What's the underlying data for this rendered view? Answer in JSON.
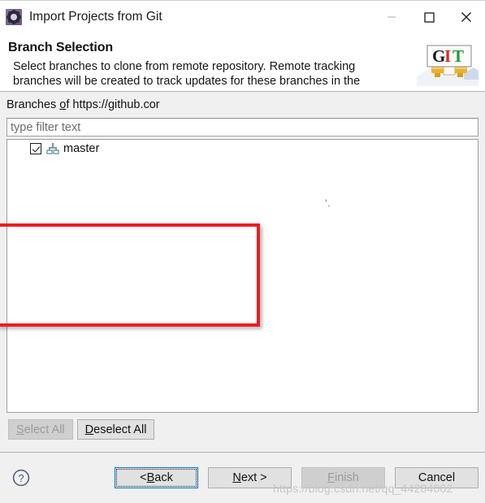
{
  "window": {
    "title": "Import Projects from Git",
    "icon": "eclipse-gear-icon",
    "controls": {
      "minimize": "minimize-icon",
      "maximize": "maximize-icon",
      "close": "close-icon"
    }
  },
  "header": {
    "title": "Branch Selection",
    "description": "Select branches to clone from remote repository. Remote tracking branches will be created to track updates for these branches in the",
    "logo": {
      "letters": [
        "G",
        "I",
        "T"
      ],
      "colors": [
        "#1a1a1a",
        "#d92c20",
        "#1f9a3c"
      ]
    }
  },
  "main": {
    "branches_label_prefix": "Branches ",
    "branches_label_mnemonic": "o",
    "branches_label_suffix": "f https://github.cor",
    "redaction_tail": "'.",
    "filter": {
      "placeholder": "type filter text",
      "value": ""
    },
    "tree": {
      "items": [
        {
          "label": "master",
          "checked": true,
          "icon": "git-branch-icon"
        }
      ]
    },
    "annotation": {
      "shape": "rectangle",
      "color": "#ee1c20"
    }
  },
  "select_bar": {
    "select_all": {
      "label_mnemonic": "S",
      "label_rest": "elect All",
      "enabled": false
    },
    "deselect_all": {
      "label_mnemonic": "D",
      "label_rest": "eselect All",
      "enabled": true
    }
  },
  "footer": {
    "help_icon": "help-question-icon",
    "buttons": [
      {
        "name": "back",
        "prefix": "< ",
        "mnemonic": "B",
        "suffix": "ack",
        "enabled": true,
        "focused": true
      },
      {
        "name": "next",
        "prefix": "",
        "mnemonic": "N",
        "suffix": "ext >",
        "enabled": true,
        "focused": false
      },
      {
        "name": "finish",
        "prefix": "",
        "mnemonic": "F",
        "suffix": "inish",
        "enabled": false,
        "focused": false
      },
      {
        "name": "cancel",
        "prefix": "",
        "mnemonic": "",
        "suffix": "Cancel",
        "enabled": true,
        "focused": false
      }
    ],
    "watermark": "https://blog.csdn.net/qq_44284002"
  }
}
